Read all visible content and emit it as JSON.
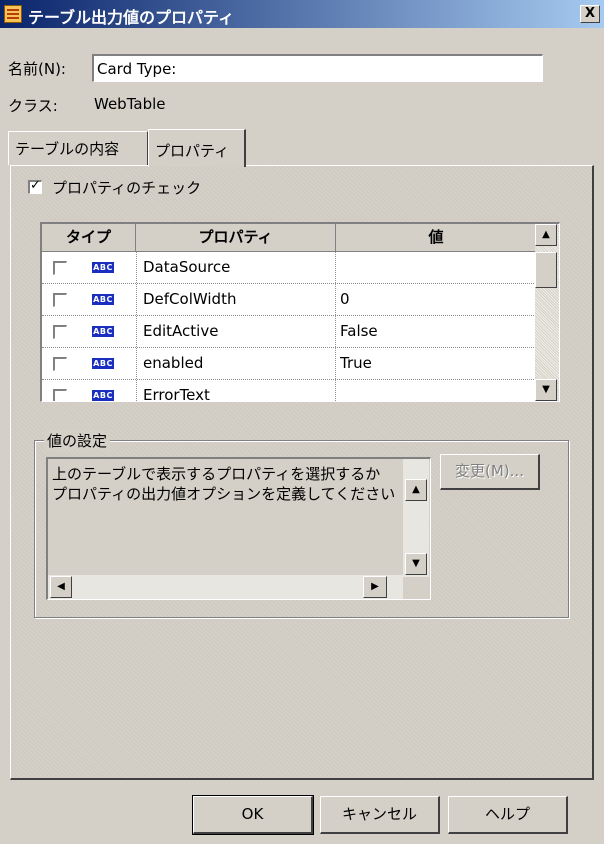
{
  "window": {
    "title": "テーブル出力値のプロパティ",
    "close_label": "X"
  },
  "name_field": {
    "label": "名前(N):",
    "value": "Card Type:"
  },
  "class_field": {
    "label": "クラス:",
    "value": "WebTable"
  },
  "tabs": [
    {
      "label": "テーブルの内容"
    },
    {
      "label": "プロパティ"
    }
  ],
  "check_properties": {
    "label": "プロパティのチェック",
    "checked": true
  },
  "grid": {
    "columns": {
      "type": "タイプ",
      "property": "プロパティ",
      "value": "値"
    },
    "type_badge": "ABC",
    "rows": [
      {
        "property": "DataSource",
        "value": ""
      },
      {
        "property": "DefColWidth",
        "value": "0"
      },
      {
        "property": "EditActive",
        "value": "False"
      },
      {
        "property": "enabled",
        "value": "True"
      },
      {
        "property": "ErrorText",
        "value": ""
      }
    ]
  },
  "value_settings": {
    "title": "値の設定",
    "message_line1": "上のテーブルで表示するプロパティを選択するか",
    "message_line2": "プロパティの出力値オプションを定義してください",
    "change_button": "変更(M)..."
  },
  "buttons": {
    "ok": "OK",
    "cancel": "キャンセル",
    "help": "ヘルプ"
  }
}
